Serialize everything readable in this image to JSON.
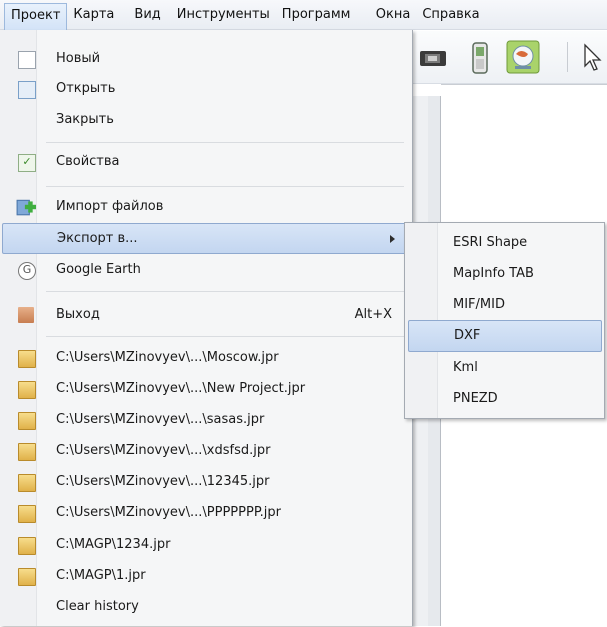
{
  "menubar": {
    "items": [
      "Проект",
      "Карта",
      "Вид",
      "Инструменты",
      "Программ",
      "Окна",
      "Справка"
    ]
  },
  "toolbar": {
    "icons": [
      "gps-device-icon",
      "handheld-gps-icon",
      "globe-icon",
      "pointer-icon"
    ]
  },
  "menu": {
    "new_label": "Новый",
    "open_label": "Открыть",
    "close_label": "Закрыть",
    "properties_label": "Свойства",
    "import_label": "Импорт файлов",
    "export_label": "Экспорт в...",
    "google_earth_label": "Google Earth",
    "exit_label": "Выход",
    "exit_shortcut": "Alt+X",
    "recent": [
      "C:\\Users\\MZinovyev\\...\\Moscow.jpr",
      "C:\\Users\\MZinovyev\\...\\New Project.jpr",
      "C:\\Users\\MZinovyev\\...\\sasas.jpr",
      "C:\\Users\\MZinovyev\\...\\xdsfsd.jpr",
      "C:\\Users\\MZinovyev\\...\\12345.jpr",
      "C:\\Users\\MZinovyev\\...\\PPPPPPP.jpr",
      "C:\\MAGP\\1234.jpr",
      "C:\\MAGP\\1.jpr"
    ],
    "clear_history_label": "Clear history"
  },
  "submenu": {
    "items": [
      "ESRI Shape",
      "MapInfo TAB",
      "MIF/MID",
      "DXF",
      "Kml",
      "PNEZD"
    ],
    "highlighted": "DXF"
  },
  "colors": {
    "highlight": "#c3d6f0",
    "highlight_border": "#8fa9cf",
    "menu_bg": "#f5f6f7"
  }
}
